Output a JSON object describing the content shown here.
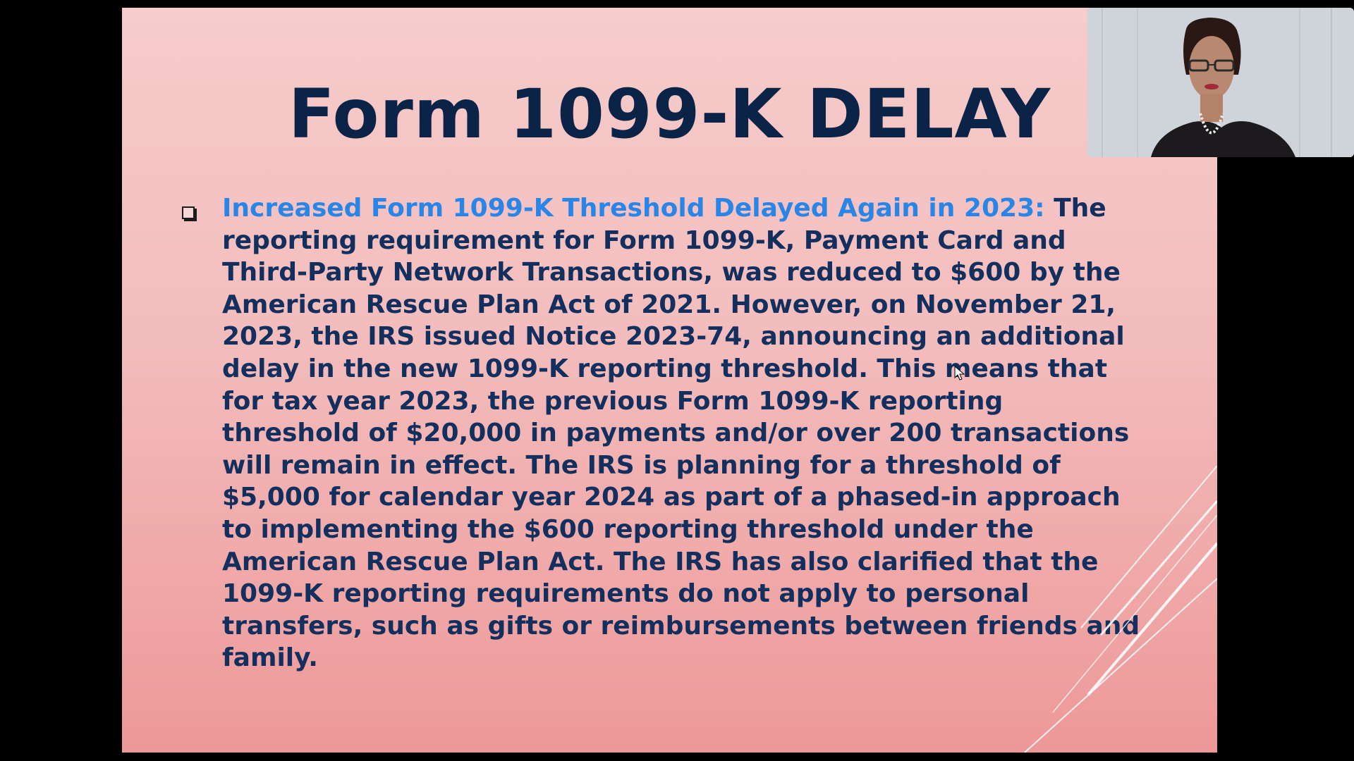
{
  "slide": {
    "title": "Form 1099-K DELAY",
    "bullet_lead": "Increased Form 1099-K Threshold Delayed Again in 2023:",
    "bullet_body": " The reporting requirement for Form 1099-K, Payment Card and Third-Party Network Transactions, was reduced to $600 by the American Rescue Plan Act of 2021. However, on November 21, 2023, the IRS issued Notice 2023-74, announcing an additional delay in the new 1099-K reporting threshold. This means that for tax year 2023, the previous Form 1099-K reporting threshold of $20,000 in payments and/or over 200 transactions will remain in effect. The IRS is planning for a threshold of $5,000 for calendar year 2024 as part of a phased-in approach to implementing the $600 reporting threshold under the American Rescue Plan Act. The IRS has also clarified that the 1099-K reporting requirements do not apply to personal transfers, such as gifts or reimbursements between friends and family."
  },
  "colors": {
    "title": "#0b2347",
    "body_text": "#132f5e",
    "lead_text": "#2a86e6",
    "slide_bg_top": "#f6cccc",
    "slide_bg_bottom": "#ed9898",
    "frame_bg": "#000000"
  },
  "webcam": {
    "icon": "presenter-video"
  },
  "cursor": {
    "icon": "mouse-pointer-icon"
  }
}
